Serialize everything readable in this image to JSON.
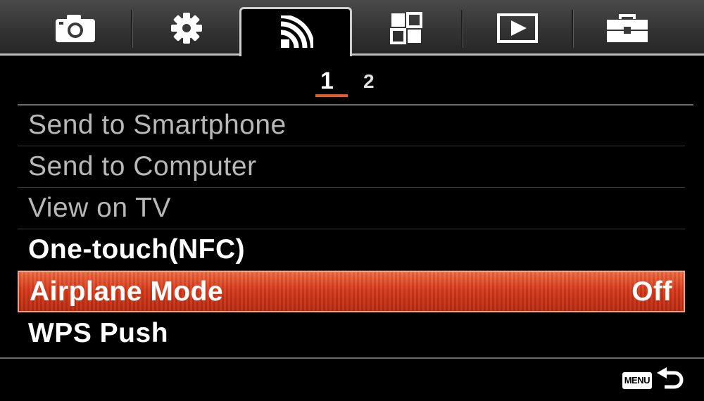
{
  "tabs": [
    {
      "icon": "camera-icon",
      "active": false
    },
    {
      "icon": "gear-icon",
      "active": false
    },
    {
      "icon": "wireless-icon",
      "active": true
    },
    {
      "icon": "application-grid-icon",
      "active": false
    },
    {
      "icon": "playback-icon",
      "active": false
    },
    {
      "icon": "toolbox-icon",
      "active": false
    }
  ],
  "pages": {
    "current": "1",
    "other": "2"
  },
  "menu": [
    {
      "label": "Send to Smartphone",
      "state": "disabled",
      "value": ""
    },
    {
      "label": "Send to Computer",
      "state": "disabled",
      "value": ""
    },
    {
      "label": "View on TV",
      "state": "disabled",
      "value": ""
    },
    {
      "label": "One-touch(NFC)",
      "state": "enabled",
      "value": ""
    },
    {
      "label": "Airplane Mode",
      "state": "selected",
      "value": "Off"
    },
    {
      "label": "WPS Push",
      "state": "enabled",
      "value": ""
    }
  ],
  "footer": {
    "menu_label": "MENU",
    "back_icon": "return-arrow-icon"
  },
  "colors": {
    "accent": "#e04a24",
    "selected_border": "#f4a080",
    "underline": "#e85a2c"
  }
}
